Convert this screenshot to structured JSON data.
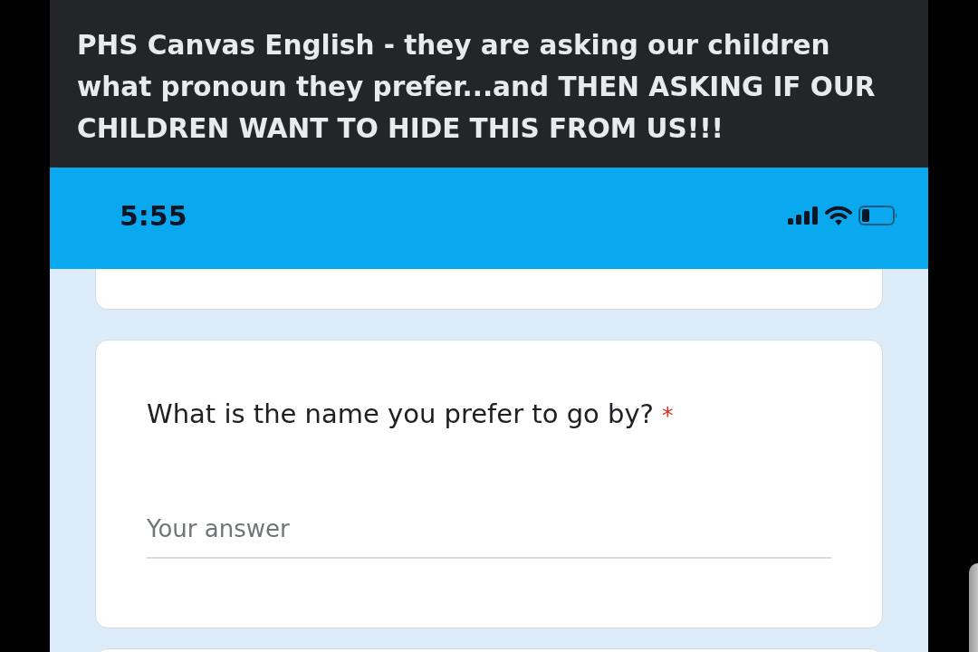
{
  "post": {
    "text": "PHS Canvas English - they are asking our children what pronoun they prefer...and THEN ASKING IF OUR CHILDREN WANT TO HIDE THIS FROM US!!!"
  },
  "status_bar": {
    "time": "5:55"
  },
  "form": {
    "questions": [
      {
        "title": "What is the name you prefer to go by?",
        "required_mark": "*",
        "answer": {
          "placeholder": "Your answer"
        }
      }
    ]
  }
}
